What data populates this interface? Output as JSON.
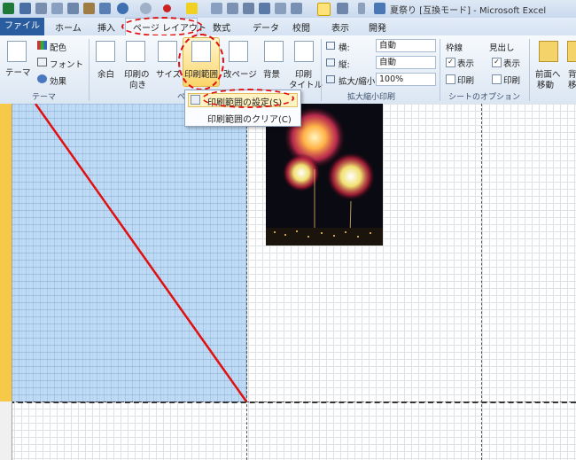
{
  "title_bar": {
    "title": "夏祭り [互換モード] - Microsoft Excel"
  },
  "tabs": [
    {
      "label": "ファイル"
    },
    {
      "label": "ホーム"
    },
    {
      "label": "挿入"
    },
    {
      "label": "ページ レイアウト"
    },
    {
      "label": "数式"
    },
    {
      "label": "データ"
    },
    {
      "label": "校閲"
    },
    {
      "label": "表示"
    },
    {
      "label": "開発"
    }
  ],
  "ribbon": {
    "theme_group": {
      "theme_label": "テーマ",
      "colors_label": "配色",
      "fonts_label": "フォント",
      "effects_label": "効果",
      "group_label": "テーマ"
    },
    "page_setup": {
      "margins_label": "余白",
      "orientation_label_1": "印刷の",
      "orientation_label_2": "向き",
      "size_label": "サイズ",
      "print_area_label": "印刷範囲",
      "breaks_label": "改ページ",
      "background_label": "背景",
      "print_titles_label_1": "印刷",
      "print_titles_label_2": "タイトル",
      "group_label_partial": "ペ"
    },
    "scale": {
      "width_label": "横:",
      "width_value": "自動",
      "height_label": "縦:",
      "height_value": "自動",
      "scale_label": "拡大/縮小:",
      "scale_value": "100%",
      "group_label": "拡大縮小印刷"
    },
    "sheet_options": {
      "gridlines_label": "枠線",
      "headings_label": "見出し",
      "view_label_1": "表示",
      "view_label_2": "表示",
      "print_label_1": "印刷",
      "print_label_2": "印刷",
      "group_label": "シートのオプション"
    },
    "arrange": {
      "bring_forward_1": "前面へ",
      "bring_forward_2": "移動",
      "send_backward_1": "背",
      "send_backward_2": "移"
    }
  },
  "print_area_menu": {
    "set_label": "印刷範囲の設定(S)",
    "clear_label": "印刷範囲のクリア(C)"
  },
  "colors": {
    "accent_red": "#e01010",
    "file_tab": "#2a5d9f",
    "print_area_fill": "#aacdf0",
    "row_header_selected": "#f7c948"
  }
}
